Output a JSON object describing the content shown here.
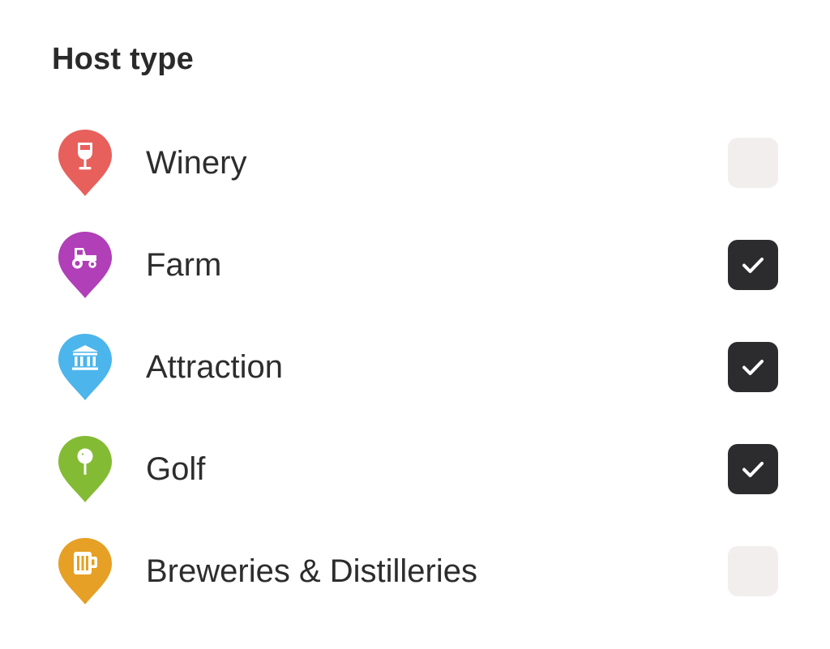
{
  "filter": {
    "title": "Host type",
    "colors": {
      "checkbox_checked": "#2c2c2e",
      "checkbox_unchecked": "#f3eeee"
    },
    "items": [
      {
        "label": "Winery",
        "icon": "wine-glass-icon",
        "color": "#e8605c",
        "checked": false
      },
      {
        "label": "Farm",
        "icon": "tractor-icon",
        "color": "#b03fb8",
        "checked": true
      },
      {
        "label": "Attraction",
        "icon": "museum-icon",
        "color": "#4bb5ec",
        "checked": true
      },
      {
        "label": "Golf",
        "icon": "golf-ball-icon",
        "color": "#84bb34",
        "checked": true
      },
      {
        "label": "Breweries & Distilleries",
        "icon": "beer-mug-icon",
        "color": "#e6a025",
        "checked": false
      }
    ]
  }
}
